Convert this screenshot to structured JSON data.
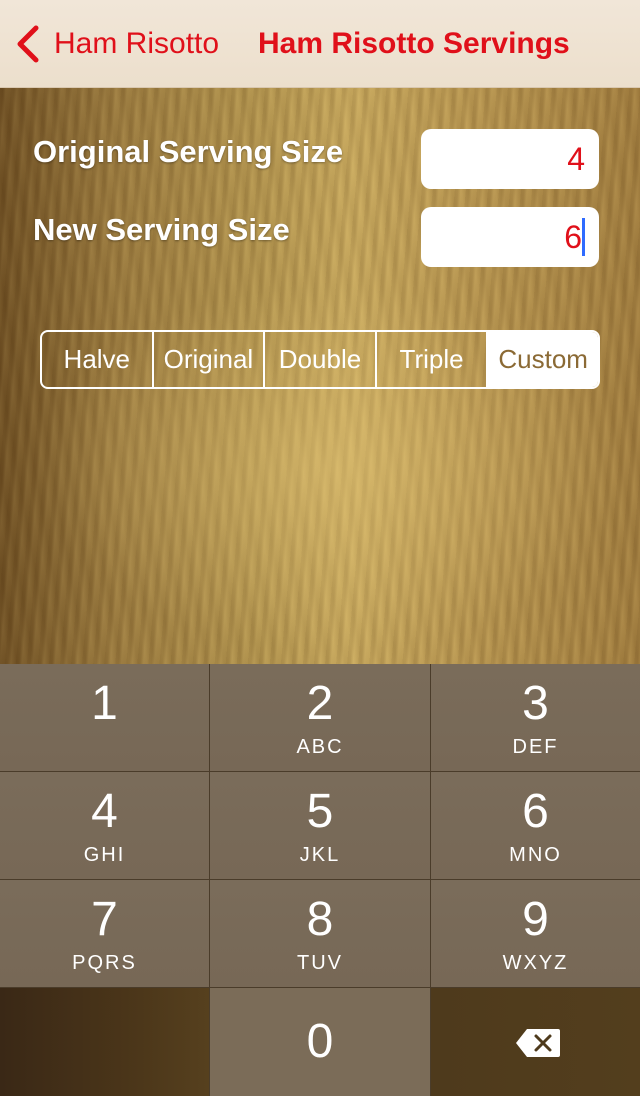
{
  "nav": {
    "back_label": "Ham Risotto",
    "title": "Ham Risotto Servings",
    "accent_color": "#e0101a"
  },
  "form": {
    "original_label": "Original Serving Size",
    "original_value": "4",
    "new_label": "New Serving Size",
    "new_value": "6"
  },
  "segments": {
    "items": [
      "Halve",
      "Original",
      "Double",
      "Triple",
      "Custom"
    ],
    "selected": "Custom"
  },
  "keypad": {
    "keys": [
      {
        "digit": "1",
        "letters": ""
      },
      {
        "digit": "2",
        "letters": "ABC"
      },
      {
        "digit": "3",
        "letters": "DEF"
      },
      {
        "digit": "4",
        "letters": "GHI"
      },
      {
        "digit": "5",
        "letters": "JKL"
      },
      {
        "digit": "6",
        "letters": "MNO"
      },
      {
        "digit": "7",
        "letters": "PQRS"
      },
      {
        "digit": "8",
        "letters": "TUV"
      },
      {
        "digit": "9",
        "letters": "WXYZ"
      },
      {
        "digit": "0",
        "letters": ""
      }
    ],
    "backspace_icon": "backspace-icon"
  }
}
